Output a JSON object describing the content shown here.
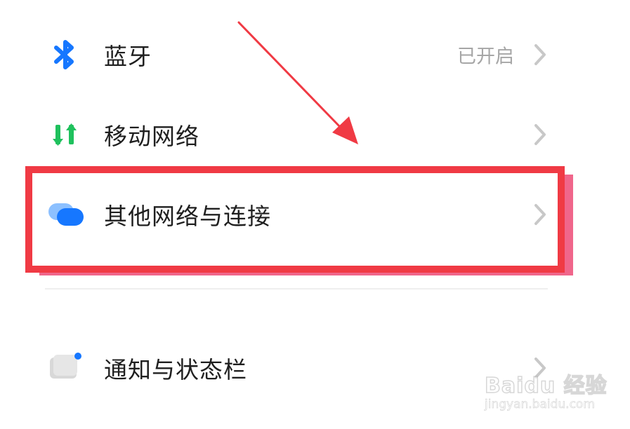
{
  "settings": {
    "items": [
      {
        "label": "蓝牙",
        "status": "已开启",
        "icon": "bluetooth-icon"
      },
      {
        "label": "移动网络",
        "status": "",
        "icon": "mobile-data-arrows-icon"
      },
      {
        "label": "其他网络与连接",
        "status": "",
        "icon": "connections-icon"
      },
      {
        "label": "通知与状态栏",
        "status": "",
        "icon": "notification-icon"
      }
    ]
  },
  "colors": {
    "bluetooth": "#1677ff",
    "mobile_network": "#1fc15d",
    "connection_front": "#1677ff",
    "connection_back": "#8cc0ff",
    "annotation_red": "#f03a44",
    "annotation_pink": "#f0668b",
    "label_text": "#1f1f1f",
    "status_text": "#a6a6a6",
    "chevron": "#c8c8c8"
  },
  "watermark": {
    "brand": "Baidu 经验",
    "url": "jingyan.baidu.com"
  }
}
